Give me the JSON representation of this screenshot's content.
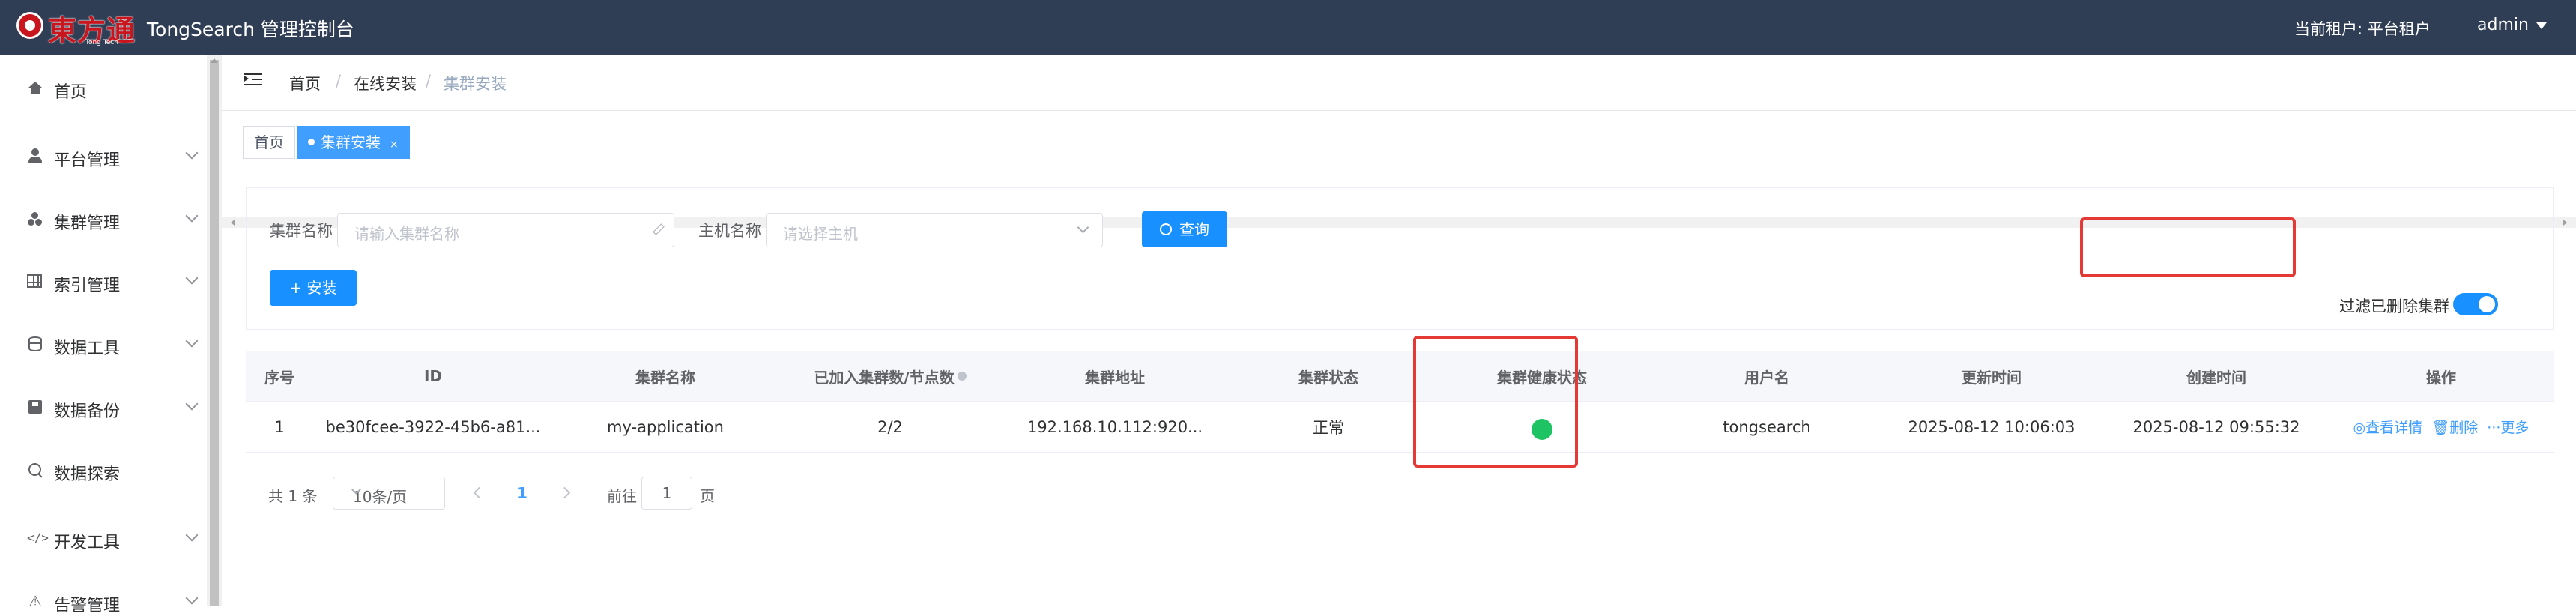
{
  "header": {
    "logo_text": "東方通",
    "logo_sub": "Tong Tech",
    "app_title": "TongSearch 管理控制台",
    "tenant_label": "当前租户:",
    "tenant_value": "平台租户",
    "user": "admin"
  },
  "sidebar": {
    "items": [
      {
        "label": "首页",
        "icon": "home-icon"
      },
      {
        "label": "平台管理",
        "icon": "user-icon"
      },
      {
        "label": "集群管理",
        "icon": "cluster-icon"
      },
      {
        "label": "索引管理",
        "icon": "grid-icon"
      },
      {
        "label": "数据工具",
        "icon": "database-icon"
      },
      {
        "label": "数据备份",
        "icon": "save-icon"
      },
      {
        "label": "数据探索",
        "icon": "search-icon"
      },
      {
        "label": "开发工具",
        "icon": "code-icon"
      },
      {
        "label": "告警管理",
        "icon": "alert-icon"
      }
    ]
  },
  "breadcrumb": {
    "items": [
      "首页",
      "在线安装",
      "集群安装"
    ]
  },
  "tags": {
    "home": "首页",
    "active": "集群安装",
    "close": "×"
  },
  "search": {
    "cluster_name_label": "集群名称",
    "cluster_name_placeholder": "请输入集群名称",
    "host_name_label": "主机名称",
    "host_name_placeholder": "请选择主机",
    "query_button": "查询",
    "install_button": "+ 安装",
    "filter_label": "过滤已删除集群",
    "filter_on": true
  },
  "table": {
    "columns": [
      "序号",
      "ID",
      "集群名称",
      "已加入集群数/节点数",
      "集群地址",
      "集群状态",
      "集群健康状态",
      "用户名",
      "更新时间",
      "创建时间",
      "操作"
    ],
    "rows": [
      {
        "index": "1",
        "id": "be30fcee-3922-45b6-a81...",
        "name": "my-application",
        "nodes": "2/2",
        "address": "192.168.10.112:920...",
        "status": "正常",
        "health_color": "#1ec463",
        "username": "tongsearch",
        "updated": "2025-08-12 10:06:03",
        "created": "2025-08-12 09:55:32",
        "ops": [
          "查看详情",
          "删除",
          "更多"
        ]
      }
    ]
  },
  "pagination": {
    "total": "共 1 条",
    "page_size": "10条/页",
    "current_page": "1",
    "goto_prefix": "前往",
    "goto_value": "1",
    "goto_suffix": "页"
  },
  "colors": {
    "header_bg": "#2f3e55",
    "primary": "#1890ff",
    "highlight": "#e53935",
    "health": "#1ec463"
  }
}
